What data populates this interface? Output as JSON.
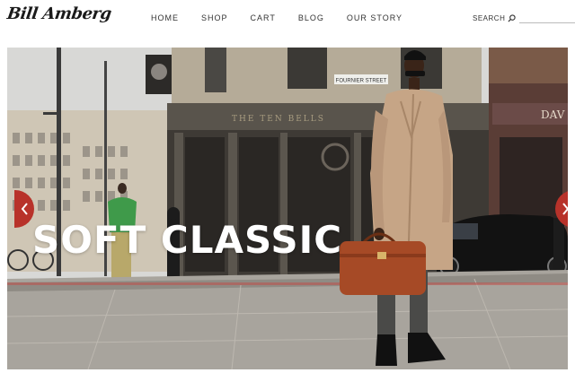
{
  "brand": {
    "logo_text": "Bill Amberg"
  },
  "nav": {
    "items": [
      {
        "label": "HOME",
        "name": "nav-home"
      },
      {
        "label": "SHOP",
        "name": "nav-shop"
      },
      {
        "label": "CART",
        "name": "nav-cart"
      },
      {
        "label": "BLOG",
        "name": "nav-blog"
      },
      {
        "label": "OUR STORY",
        "name": "nav-our-story"
      }
    ]
  },
  "search": {
    "label": "SEARCH",
    "value": "",
    "placeholder": ""
  },
  "hero": {
    "headline": "SOFT CLASSIC",
    "street_sign": "FOURNIER STREET",
    "pub_sign": "THE TEN BELLS",
    "shop_sign": "DAV",
    "prev_icon": "chevron-left-icon",
    "next_icon": "chevron-right-icon",
    "accent_color": "#b8322a"
  }
}
